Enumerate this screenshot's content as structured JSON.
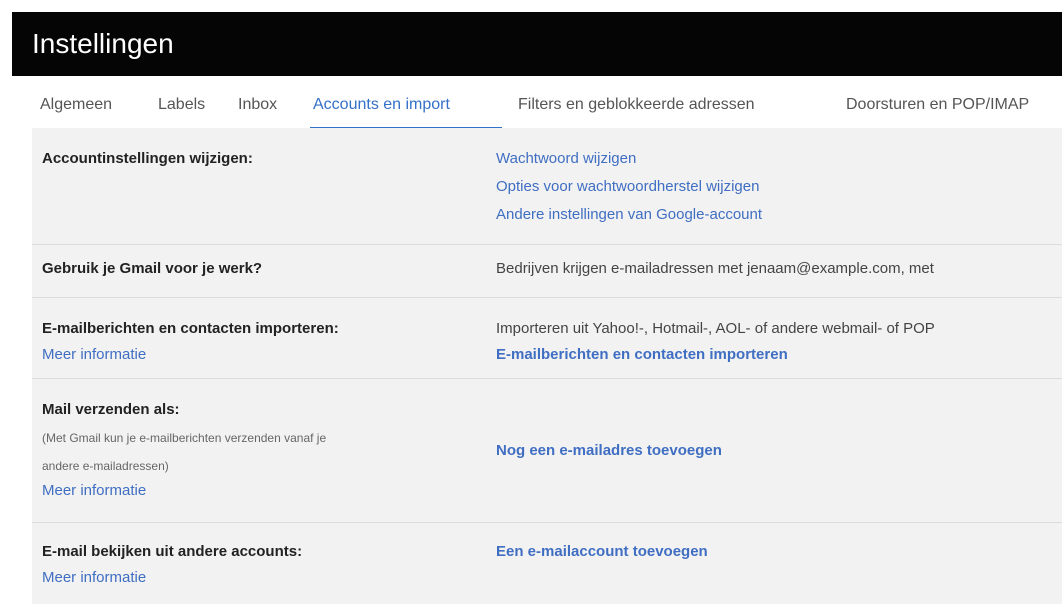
{
  "header": {
    "title": "Instellingen"
  },
  "tabs": [
    {
      "label": "Algemeen"
    },
    {
      "label": "Labels"
    },
    {
      "label": "Inbox"
    },
    {
      "label": "Accounts en import"
    },
    {
      "label": "Filters en geblokkeerde adressen"
    },
    {
      "label": "Doorsturen en POP/IMAP"
    }
  ],
  "active_tab": "Accounts en import",
  "rows": {
    "account": {
      "label": "Accountinstellingen wijzigen:",
      "links": [
        "Wachtwoord wijzigen",
        "Opties voor wachtwoordherstel wijzigen",
        "Andere instellingen van Google-account"
      ]
    },
    "work": {
      "label": "Gebruik je Gmail voor je werk?",
      "text": "Bedrijven krijgen e-mailadressen met jenaam@example.com, met"
    },
    "import": {
      "label": "E-mailberichten en contacten importeren:",
      "more": "Meer informatie",
      "text": "Importeren uit Yahoo!-, Hotmail-, AOL- of andere webmail- of POP",
      "action": "E-mailberichten en contacten importeren"
    },
    "sendas": {
      "label": "Mail verzenden als:",
      "sub_line1": "(Met Gmail kun je e-mailberichten verzenden vanaf je",
      "sub_line2": "andere e-mailadressen)",
      "more": "Meer informatie",
      "action": "Nog een e-mailadres toevoegen"
    },
    "check": {
      "label": "E-mail bekijken uit andere accounts:",
      "more": "Meer informatie",
      "action": "Een e-mailaccount toevoegen"
    }
  },
  "colors": {
    "header_bg": "#050505",
    "accent": "#3370c8",
    "link": "#3f6ec2",
    "content_bg": "#f2f2f2"
  }
}
